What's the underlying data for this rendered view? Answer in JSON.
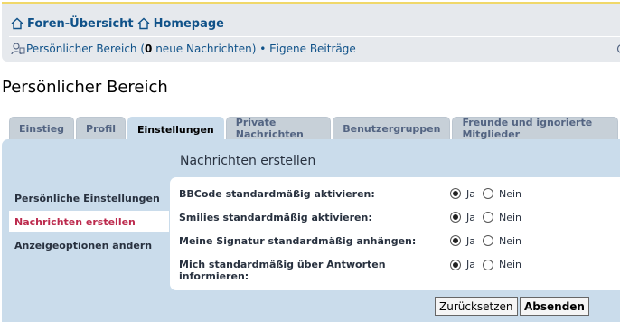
{
  "nav": {
    "forum_index": "Foren-Übersicht",
    "homepage": "Homepage",
    "ucp_link": "Persönlicher Bereich",
    "messages_open": " (",
    "new_count": "0",
    "messages_rest": " neue Nachrichten) • ",
    "own_posts": "Eigene Beiträge",
    "icons": [
      "home-icon",
      "home-icon",
      "user-icon",
      "search-icon"
    ]
  },
  "page_title": "Persönlicher Bereich",
  "tabs": [
    {
      "label": "Einstieg",
      "active": false
    },
    {
      "label": "Profil",
      "active": false
    },
    {
      "label": "Einstellungen",
      "active": true
    },
    {
      "label": "Private Nachrichten",
      "active": false
    },
    {
      "label": "Benutzergruppen",
      "active": false
    },
    {
      "label": "Freunde und ignorierte Mitglieder",
      "active": false
    }
  ],
  "sidebar": {
    "items": [
      {
        "label": "Persönliche Einstellungen",
        "active": false
      },
      {
        "label": "Nachrichten erstellen",
        "active": true
      },
      {
        "label": "Anzeigeoptionen ändern",
        "active": false
      }
    ]
  },
  "section_title": "Nachrichten erstellen",
  "form": {
    "yes": "Ja",
    "no": "Nein",
    "rows": [
      {
        "label": "BBCode standardmäßig aktivieren:",
        "value": "Ja"
      },
      {
        "label": "Smilies standardmäßig aktivieren:",
        "value": "Ja"
      },
      {
        "label": "Meine Signatur standardmäßig anhängen:",
        "value": "Ja"
      },
      {
        "label": "Mich standardmäßig über Antworten informieren:",
        "value": "Ja"
      }
    ]
  },
  "buttons": {
    "reset": "Zurücksetzen",
    "submit": "Absenden"
  },
  "colors": {
    "link": "#105289",
    "active_side": "#bc2a4d",
    "panel": "#cadceb",
    "nav_bg": "#e6e9ed"
  }
}
